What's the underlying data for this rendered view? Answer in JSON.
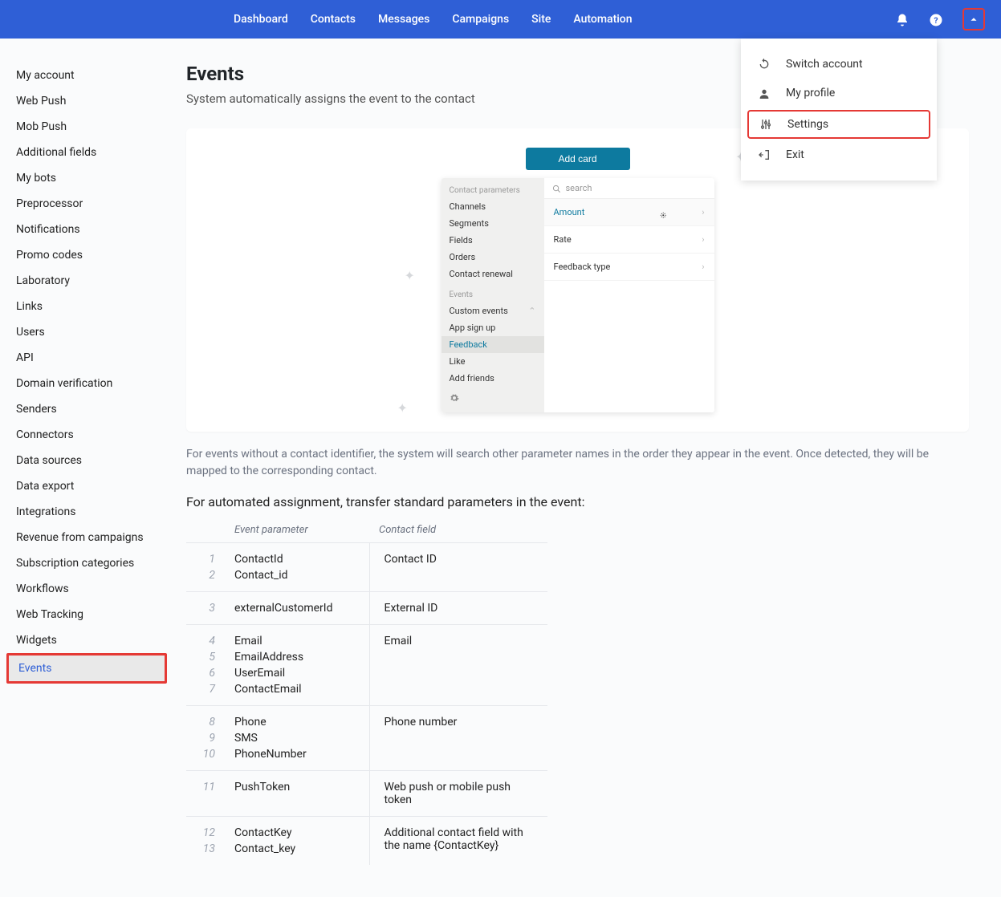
{
  "topnav": {
    "items": [
      "Dashboard",
      "Contacts",
      "Messages",
      "Campaigns",
      "Site",
      "Automation"
    ]
  },
  "dropdown": {
    "switch": "Switch account",
    "profile": "My profile",
    "settings": "Settings",
    "exit": "Exit"
  },
  "sidebar": {
    "items": [
      {
        "label": "My account"
      },
      {
        "label": "Web Push"
      },
      {
        "label": "Mob Push"
      },
      {
        "label": "Additional fields"
      },
      {
        "label": "My bots"
      },
      {
        "label": "Preprocessor"
      },
      {
        "label": "Notifications"
      },
      {
        "label": "Promo codes"
      },
      {
        "label": "Laboratory"
      },
      {
        "label": "Links"
      },
      {
        "label": "Users"
      },
      {
        "label": "API"
      },
      {
        "label": "Domain verification"
      },
      {
        "label": "Senders"
      },
      {
        "label": "Connectors"
      },
      {
        "label": "Data sources"
      },
      {
        "label": "Data export"
      },
      {
        "label": "Integrations"
      },
      {
        "label": "Revenue from campaigns"
      },
      {
        "label": "Subscription categories"
      },
      {
        "label": "Workflows"
      },
      {
        "label": "Web Tracking"
      },
      {
        "label": "Widgets"
      },
      {
        "label": "Events",
        "active": true
      }
    ]
  },
  "page": {
    "title": "Events",
    "subtitle": "System automatically assigns the event to the contact",
    "note": "For events without a contact identifier, the system will search other parameter names in the order they appear in the event. Once detected, they will be mapped to the corresponding contact.",
    "heading2": "For automated assignment, transfer standard parameters in the event:"
  },
  "illus": {
    "add_card": "Add card",
    "group1": "Contact parameters",
    "channels": "Channels",
    "segments": "Segments",
    "fields": "Fields",
    "orders": "Orders",
    "renewal": "Contact renewal",
    "group2": "Events",
    "custom": "Custom events",
    "appsignup": "App sign up",
    "feedback": "Feedback",
    "like": "Like",
    "addfriends": "Add friends",
    "search_placeholder": "search",
    "amount": "Amount",
    "rate": "Rate",
    "ftype": "Feedback type"
  },
  "table": {
    "h_param": "Event parameter",
    "h_field": "Contact field",
    "groups": [
      {
        "field": "Contact ID",
        "params": [
          {
            "n": "1",
            "p": "ContactId"
          },
          {
            "n": "2",
            "p": "Contact_id"
          }
        ]
      },
      {
        "field": "External ID",
        "params": [
          {
            "n": "3",
            "p": "externalCustomerId"
          }
        ]
      },
      {
        "field": "Email",
        "params": [
          {
            "n": "4",
            "p": "Email"
          },
          {
            "n": "5",
            "p": "EmailAddress"
          },
          {
            "n": "6",
            "p": "UserEmail"
          },
          {
            "n": "7",
            "p": "ContactEmail"
          }
        ]
      },
      {
        "field": "Phone number",
        "params": [
          {
            "n": "8",
            "p": "Phone"
          },
          {
            "n": "9",
            "p": "SMS"
          },
          {
            "n": "10",
            "p": "PhoneNumber"
          }
        ]
      },
      {
        "field": "Web push or mobile push token",
        "params": [
          {
            "n": "11",
            "p": "PushToken"
          }
        ]
      },
      {
        "field": "Additional contact field with the name {ContactKey}",
        "params": [
          {
            "n": "12",
            "p": "ContactKey"
          },
          {
            "n": "13",
            "p": "Contact_key"
          }
        ]
      }
    ]
  }
}
